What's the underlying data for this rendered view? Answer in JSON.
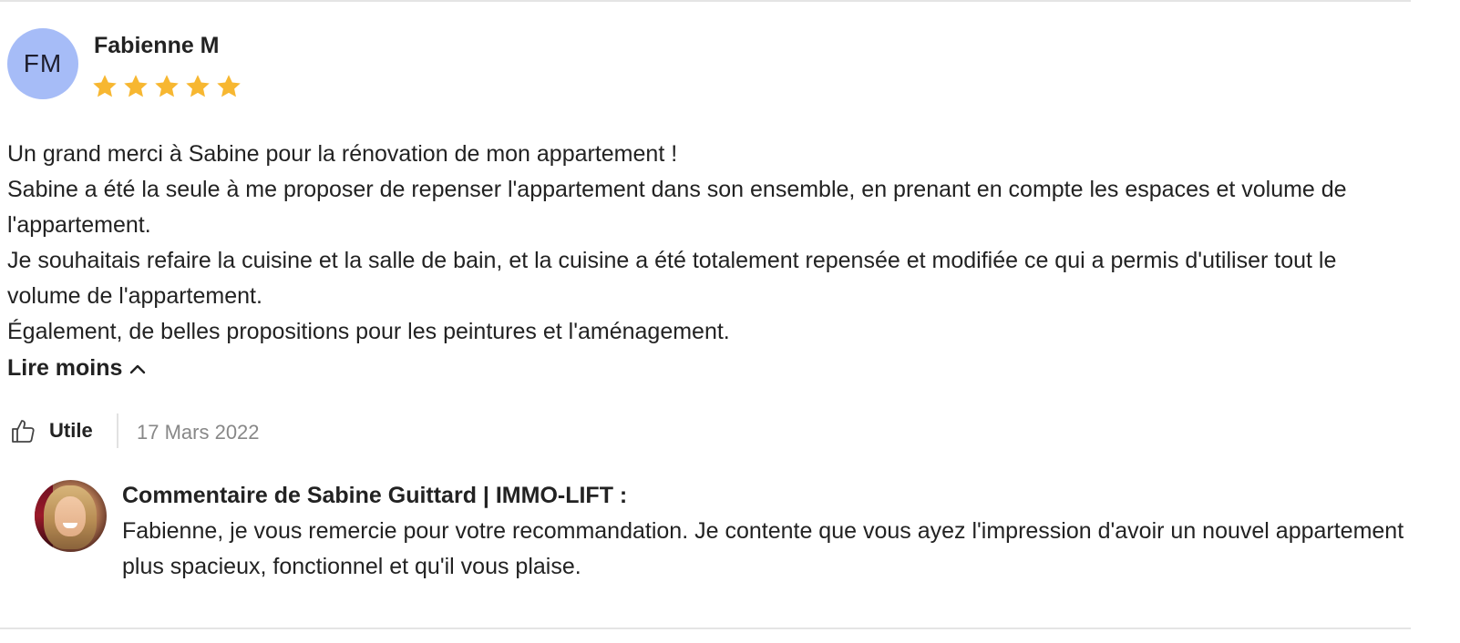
{
  "review": {
    "author_initials": "FM",
    "author_name": "Fabienne M",
    "rating": 5,
    "rating_max": 5,
    "star_color": "#f7b731",
    "avatar_color": "#a6bcf7",
    "body_lines": [
      "Un grand merci à Sabine pour la rénovation de mon appartement !",
      "Sabine a été la seule à me proposer de repenser l'appartement dans son ensemble, en prenant en compte les espaces et volume de l'appartement.",
      "Je souhaitais refaire la cuisine et la salle de bain, et la cuisine a été totalement repensée et modifiée ce qui a permis d'utiliser tout le volume de l'appartement.",
      "Également, de belles propositions pour les peintures et l'aménagement."
    ],
    "read_less_label": "Lire moins",
    "helpful_label": "Utile",
    "date": "17 Mars 2022"
  },
  "owner_response": {
    "heading": "Commentaire de Sabine Guittard | IMMO-LIFT :",
    "text": "Fabienne, je vous remercie pour votre recommandation. Je contente que vous ayez l'impression d'avoir un nouvel appartement plus spacieux, fonctionnel et qu'il vous plaise."
  },
  "icons": {
    "star": "star-icon",
    "chevron": "chevron-up-icon",
    "helpful": "thumbs-up-icon"
  }
}
